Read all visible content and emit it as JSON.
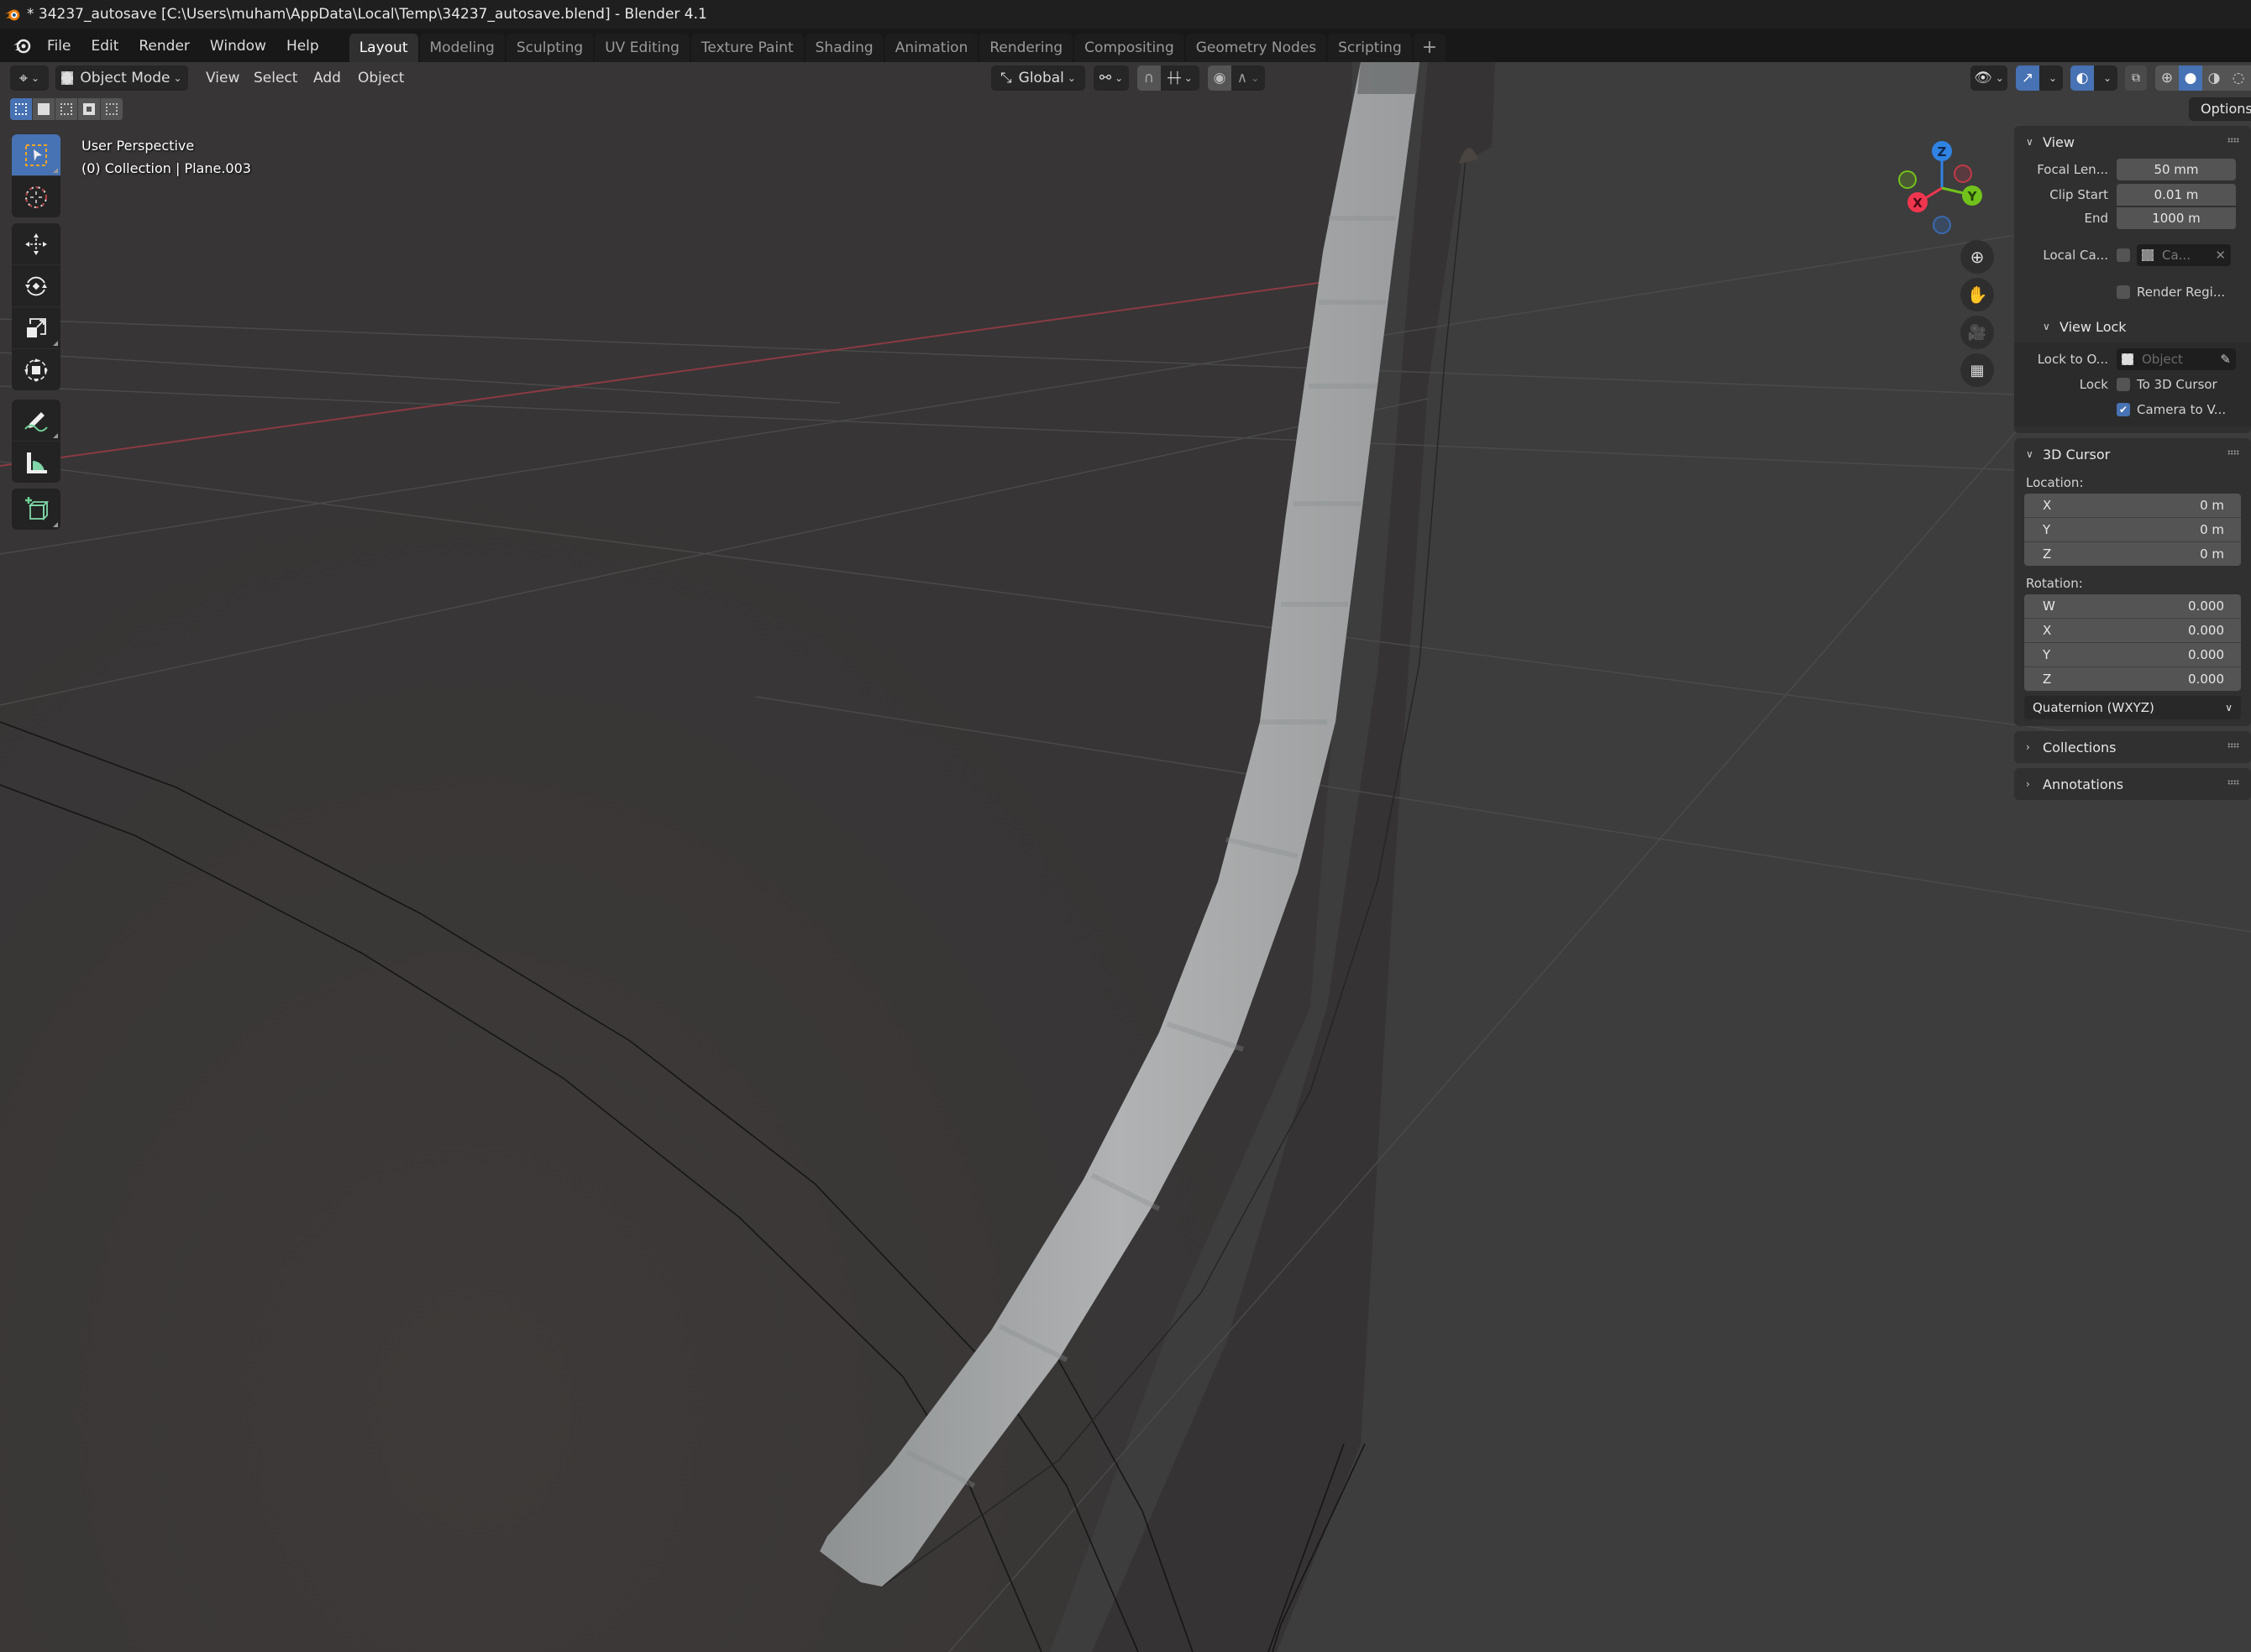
{
  "window": {
    "title": "* 34237_autosave [C:\\Users\\muham\\AppData\\Local\\Temp\\34237_autosave.blend] - Blender 4.1"
  },
  "menu": {
    "items": [
      "File",
      "Edit",
      "Render",
      "Window",
      "Help"
    ]
  },
  "workspaces": {
    "tabs": [
      "Layout",
      "Modeling",
      "Sculpting",
      "UV Editing",
      "Texture Paint",
      "Shading",
      "Animation",
      "Rendering",
      "Compositing",
      "Geometry Nodes",
      "Scripting"
    ],
    "active": "Layout",
    "add_label": "+"
  },
  "viewport_header": {
    "editor_type_icon": "3d-viewport-icon",
    "mode": "Object Mode",
    "menus": [
      "View",
      "Select",
      "Add",
      "Object"
    ],
    "transform_orientation": "Global",
    "pivot_icon": "pivot-point-icon",
    "snap_icon": "magnet-icon",
    "snap_target_icon": "snap-increment-icon",
    "proportional_icon": "proportional-edit-icon",
    "falloff_icon": "falloff-curve-icon",
    "visibility_icon": "selectability-visibility-icon",
    "gizmo_icon": "gizmo-icon",
    "overlay_icon": "overlay-icon",
    "xray_icon": "xray-icon",
    "shading_modes": [
      "wireframe",
      "solid",
      "material-preview",
      "rendered"
    ],
    "active_shading": "solid",
    "options_label": "Options"
  },
  "select_modes": [
    "set-new",
    "extend",
    "subtract",
    "difference",
    "intersect"
  ],
  "toolbar": {
    "tools": [
      {
        "name": "select-box",
        "active": true
      },
      {
        "name": "cursor",
        "active": false
      },
      {
        "name": "move",
        "active": false
      },
      {
        "name": "rotate",
        "active": false
      },
      {
        "name": "scale",
        "active": false
      },
      {
        "name": "transform",
        "active": false
      },
      {
        "name": "annotate",
        "active": false
      },
      {
        "name": "measure",
        "active": false
      },
      {
        "name": "add-cube",
        "active": false
      }
    ]
  },
  "viewport_info": {
    "view_name": "User Perspective",
    "collection_line": "(0) Collection | Plane.003"
  },
  "gizmo": {
    "axes": [
      "X",
      "Y",
      "Z"
    ],
    "colors": {
      "x": "#f0364f",
      "y": "#72c21c",
      "z": "#2f83e3"
    }
  },
  "npanel": {
    "view": {
      "title": "View",
      "focal_length_label": "Focal Len...",
      "focal_length": "50 mm",
      "clip_start_label": "Clip Start",
      "clip_start": "0.01 m",
      "clip_end_label": "End",
      "clip_end": "1000 m",
      "local_camera_label": "Local Ca...",
      "local_camera_value": "Ca...",
      "local_camera_checked": false,
      "render_region_label": "Render Regi...",
      "render_region_checked": false
    },
    "view_lock": {
      "title": "View Lock",
      "lock_to_object_label": "Lock to O...",
      "lock_to_object_placeholder": "Object",
      "lock_label": "Lock",
      "to_3d_cursor_label": "To 3D Cursor",
      "to_3d_cursor_checked": false,
      "camera_to_view_label": "Camera to V...",
      "camera_to_view_checked": true
    },
    "cursor": {
      "title": "3D Cursor",
      "location_label": "Location:",
      "location": [
        {
          "axis": "X",
          "value": "0 m"
        },
        {
          "axis": "Y",
          "value": "0 m"
        },
        {
          "axis": "Z",
          "value": "0 m"
        }
      ],
      "rotation_label": "Rotation:",
      "rotation": [
        {
          "axis": "W",
          "value": "0.000"
        },
        {
          "axis": "X",
          "value": "0.000"
        },
        {
          "axis": "Y",
          "value": "0.000"
        },
        {
          "axis": "Z",
          "value": "0.000"
        }
      ],
      "rotation_mode": "Quaternion (WXYZ)"
    },
    "collections": {
      "title": "Collections"
    },
    "annotations": {
      "title": "Annotations"
    }
  },
  "colors": {
    "accent": "#4772b3",
    "viewport_bg": "#3d3d3d",
    "object_grey": "#a8aaab"
  }
}
